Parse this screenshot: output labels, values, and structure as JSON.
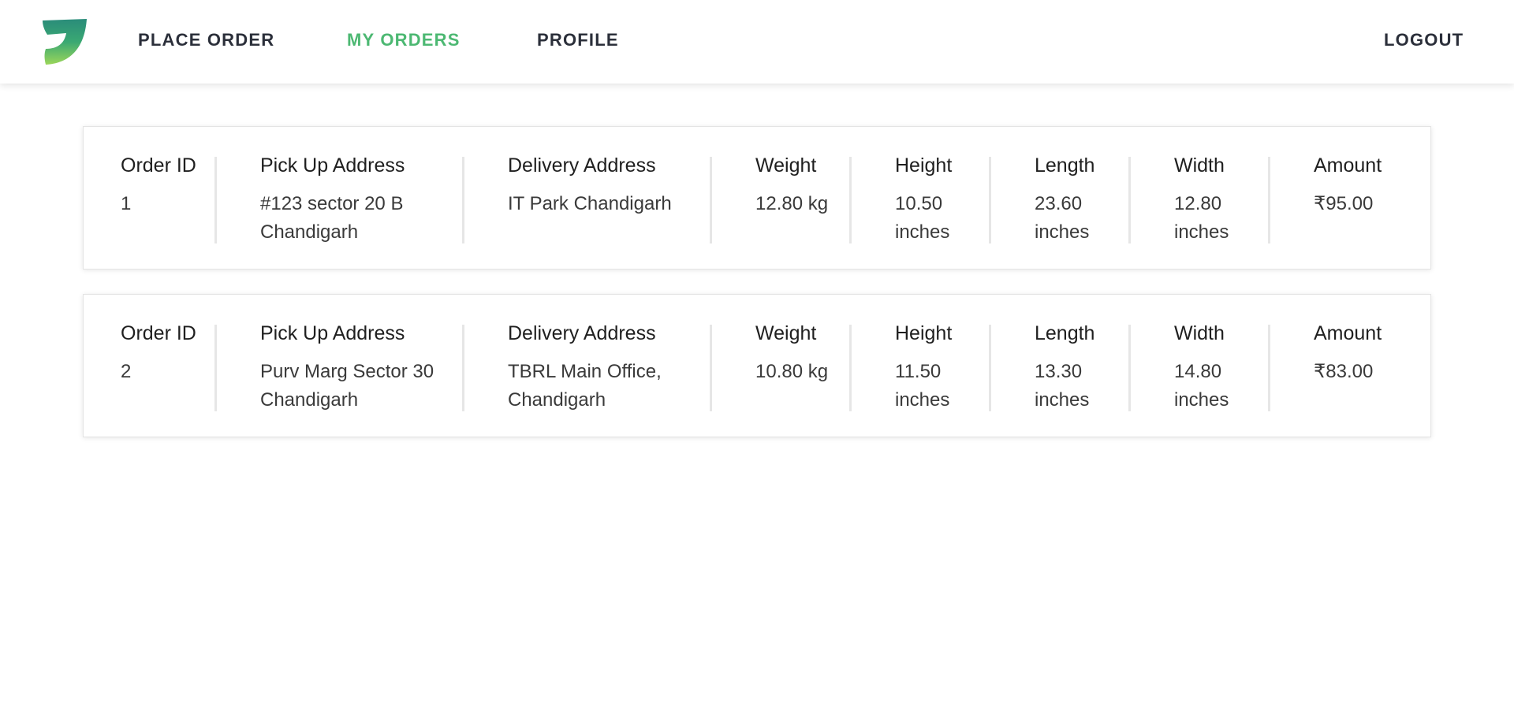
{
  "nav": {
    "place_order": "PLACE ORDER",
    "my_orders": "MY ORDERS",
    "profile": "PROFILE",
    "logout": "LOGOUT",
    "active": "my_orders"
  },
  "colors": {
    "accent": "#4cb872",
    "nav_text": "#2b2f3a"
  },
  "headers": {
    "order_id": "Order ID",
    "pickup": "Pick Up Address",
    "delivery": "Delivery Address",
    "weight": "Weight",
    "height": "Height",
    "length": "Length",
    "width": "Width",
    "amount": "Amount"
  },
  "orders": [
    {
      "order_id": "1",
      "pickup": "#123 sector 20 B Chandigarh",
      "delivery": "IT Park Chandigarh",
      "weight": "12.80 kg",
      "height": "10.50 inches",
      "length": "23.60 inches",
      "width": "12.80 inches",
      "amount": "₹95.00"
    },
    {
      "order_id": "2",
      "pickup": "Purv Marg Sector 30 Chandigarh",
      "delivery": "TBRL Main Office, Chandigarh",
      "weight": "10.80 kg",
      "height": "11.50 inches",
      "length": "13.30 inches",
      "width": "14.80 inches",
      "amount": "₹83.00"
    }
  ]
}
